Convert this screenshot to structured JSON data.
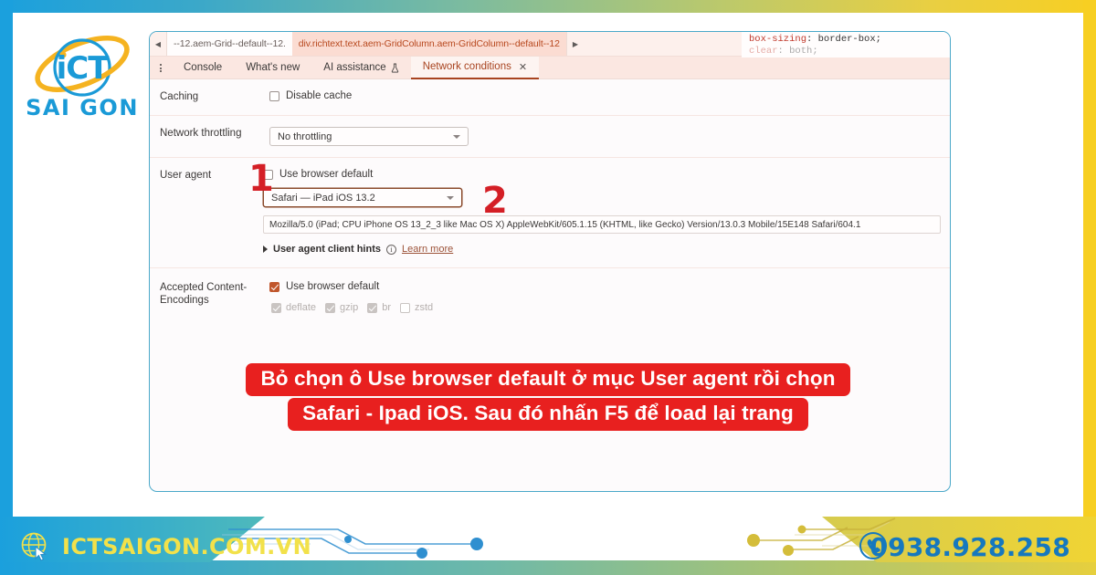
{
  "frame": {
    "top_gradient_from": "#1ba0dd",
    "top_gradient_to": "#f7cf22",
    "left_strip_color": "#1ba0dd",
    "right_strip_color": "#f7cf22"
  },
  "logo": {
    "primary_text": "iCT",
    "secondary_text": "SAI GON",
    "ring_color": "#f5b320",
    "text_color": "#1a9ad7"
  },
  "devtools": {
    "breadcrumb": {
      "scroll_left_icon": "triangle-left-icon",
      "scroll_right_icon": "triangle-right-icon",
      "items": [
        {
          "label": "--12.aem-Grid--default--12.",
          "active": false
        },
        {
          "label": "div.richtext.text.aem-GridColumn.aem-GridColumn--default--12",
          "active": true
        }
      ]
    },
    "css_preview": {
      "line1_prop": "box-sizing",
      "line1_value": " border-box;",
      "line2_prop": "clear",
      "line2_value": " both;"
    },
    "tabs": {
      "menu_icon": "kebab-menu-icon",
      "items": [
        {
          "label": "Console",
          "active": false,
          "icon": null,
          "closable": false
        },
        {
          "label": "What's new",
          "active": false,
          "icon": null,
          "closable": false
        },
        {
          "label": "AI assistance",
          "active": false,
          "icon": "flask-icon",
          "closable": false
        },
        {
          "label": "Network conditions",
          "active": true,
          "icon": null,
          "closable": true,
          "close_icon": "close-icon"
        }
      ]
    },
    "rows": {
      "caching": {
        "label": "Caching",
        "checkbox_label": "Disable cache",
        "checked": false
      },
      "throttling": {
        "label": "Network throttling",
        "selected": "No throttling",
        "caret_icon": "chevron-down-icon"
      },
      "user_agent": {
        "label": "User agent",
        "checkbox_label": "Use browser default",
        "checked": false,
        "selected": "Safari — iPad iOS 13.2",
        "caret_icon": "chevron-down-icon",
        "ua_string": "Mozilla/5.0 (iPad; CPU iPhone OS 13_2_3 like Mac OS X) AppleWebKit/605.1.15 (KHTML, like Gecko) Version/13.0.3 Mobile/15E148 Safari/604.1",
        "hints_expander_icon": "triangle-right-icon",
        "hints_title": "User agent client hints",
        "hints_info_icon": "info-icon",
        "hints_link": "Learn more"
      },
      "encodings": {
        "label_line1": "Accepted Content-",
        "label_line2": "Encodings",
        "checkbox_label": "Use browser default",
        "checked": true,
        "options": [
          {
            "label": "deflate",
            "checked": true,
            "disabled": true
          },
          {
            "label": "gzip",
            "checked": true,
            "disabled": true
          },
          {
            "label": "br",
            "checked": true,
            "disabled": true
          },
          {
            "label": "zstd",
            "checked": false,
            "disabled": true
          }
        ]
      }
    }
  },
  "annotations": {
    "color": "#d41f26",
    "markers": [
      {
        "id": "1",
        "label": "1"
      },
      {
        "id": "2",
        "label": "2"
      }
    ]
  },
  "caption": {
    "background": "#e8201f",
    "line1": "Bỏ chọn ô Use browser default ở mục User agent rồi chọn",
    "line2": "Safari - Ipad iOS. Sau đó nhấn F5 để load lại trang"
  },
  "footer": {
    "website_icon": "globe-cursor-icon",
    "website": "ICTSAIGON.COM.VN",
    "website_color": "#f2e14a",
    "phone_icon": "phone-icon",
    "phone": "0938.928.258",
    "phone_color": "#1678be",
    "left_panel_color": "#1ba0dd",
    "right_panel_color": "#e3cf3c"
  }
}
